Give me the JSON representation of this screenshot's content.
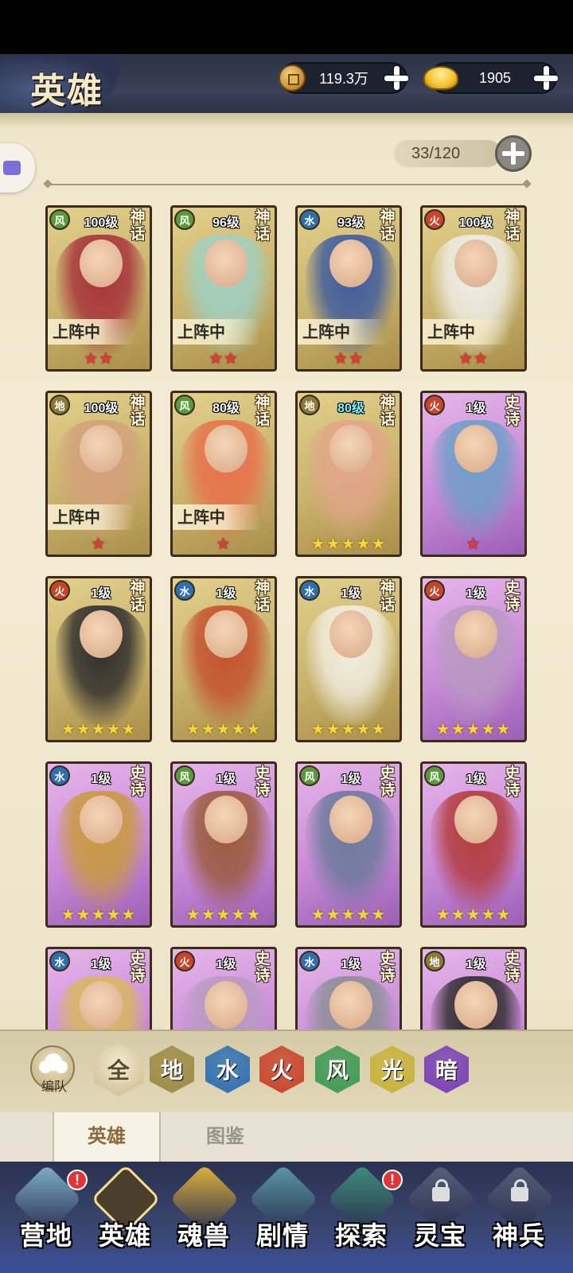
{
  "header": {
    "title": "英雄",
    "currencies": [
      {
        "icon": "copper-coin-icon",
        "amount": "119.3万"
      },
      {
        "icon": "gold-ingot-icon",
        "amount": "1905"
      }
    ]
  },
  "roster": {
    "capacity": "33/120"
  },
  "rarity_labels": {
    "myth": "神话",
    "epic": "史诗"
  },
  "elements": {
    "风": "#5a9a3a",
    "水": "#2e6fae",
    "火": "#c8442a",
    "地": "#8a7a3a"
  },
  "cards": [
    {
      "element": "风",
      "level": "100级",
      "rarity": "myth",
      "deployed": "上阵中",
      "stars": "★★",
      "star_color": "red",
      "tint": "#a6303a"
    },
    {
      "element": "风",
      "level": "96级",
      "rarity": "myth",
      "deployed": "上阵中",
      "stars": "★★",
      "star_color": "red",
      "tint": "#9fd1c4"
    },
    {
      "element": "水",
      "level": "93级",
      "rarity": "myth",
      "deployed": "上阵中",
      "stars": "★★",
      "star_color": "red",
      "tint": "#3b5aa0"
    },
    {
      "element": "火",
      "level": "100级",
      "rarity": "myth",
      "deployed": "上阵中",
      "stars": "★★",
      "star_color": "red",
      "tint": "#efefea"
    },
    {
      "element": "地",
      "level": "100级",
      "rarity": "myth",
      "deployed": "上阵中",
      "stars": "★",
      "star_color": "red",
      "tint": "#d3a07a"
    },
    {
      "element": "风",
      "level": "80级",
      "rarity": "myth",
      "deployed": "上阵中",
      "stars": "★",
      "star_color": "red",
      "tint": "#e9704a"
    },
    {
      "element": "地",
      "level": "80级",
      "rarity": "myth",
      "deployed": "",
      "stars": "★★★★★",
      "star_color": "gold",
      "tint": "#e2a58a",
      "level_cyan": true
    },
    {
      "element": "火",
      "level": "1级",
      "rarity": "epic",
      "deployed": "",
      "stars": "★",
      "star_color": "red",
      "tint": "#6d9ec8"
    },
    {
      "element": "火",
      "level": "1级",
      "rarity": "myth",
      "deployed": "",
      "stars": "★★★★★",
      "star_color": "gold",
      "tint": "#2b2b2b"
    },
    {
      "element": "水",
      "level": "1级",
      "rarity": "myth",
      "deployed": "",
      "stars": "★★★★★",
      "star_color": "gold",
      "tint": "#c4502e"
    },
    {
      "element": "水",
      "level": "1级",
      "rarity": "myth",
      "deployed": "",
      "stars": "★★★★★",
      "star_color": "gold",
      "tint": "#f2efe2"
    },
    {
      "element": "火",
      "level": "1级",
      "rarity": "epic",
      "deployed": "",
      "stars": "★★★★★",
      "star_color": "gold",
      "tint": "#b89ac2"
    },
    {
      "element": "水",
      "level": "1级",
      "rarity": "epic",
      "deployed": "",
      "stars": "★★★★★",
      "star_color": "gold",
      "tint": "#c99a3a"
    },
    {
      "element": "风",
      "level": "1级",
      "rarity": "epic",
      "deployed": "",
      "stars": "★★★★★",
      "star_color": "gold",
      "tint": "#9a5a3a"
    },
    {
      "element": "风",
      "level": "1级",
      "rarity": "epic",
      "deployed": "",
      "stars": "★★★★★",
      "star_color": "gold",
      "tint": "#6a7a9a"
    },
    {
      "element": "风",
      "level": "1级",
      "rarity": "epic",
      "deployed": "",
      "stars": "★★★★★",
      "star_color": "gold",
      "tint": "#b23a3a"
    },
    {
      "element": "水",
      "level": "1级",
      "rarity": "epic",
      "deployed": "",
      "stars": "",
      "star_color": "gold",
      "tint": "#d9b85a"
    },
    {
      "element": "火",
      "level": "1级",
      "rarity": "epic",
      "deployed": "",
      "stars": "",
      "star_color": "gold",
      "tint": "#b89ac2"
    },
    {
      "element": "水",
      "level": "1级",
      "rarity": "epic",
      "deployed": "",
      "stars": "",
      "star_color": "gold",
      "tint": "#8a8f96"
    },
    {
      "element": "地",
      "level": "1级",
      "rarity": "epic",
      "deployed": "",
      "stars": "",
      "star_color": "gold",
      "tint": "#2b2b2b"
    }
  ],
  "filters": {
    "team_label": "编队",
    "chips": [
      {
        "label": "全",
        "color": "#c9b98a",
        "selected": true
      },
      {
        "label": "地",
        "color": "#9d8a45"
      },
      {
        "label": "水",
        "color": "#2f6fb3"
      },
      {
        "label": "火",
        "color": "#c8442a"
      },
      {
        "label": "风",
        "color": "#3e9a55"
      },
      {
        "label": "光",
        "color": "#c9b23a"
      },
      {
        "label": "暗",
        "color": "#7a3fb8"
      }
    ]
  },
  "tabs": [
    {
      "label": "英雄",
      "active": true
    },
    {
      "label": "图鉴",
      "active": false
    }
  ],
  "nav": [
    {
      "label": "营地",
      "badge": "!",
      "color": "#7fb0c9"
    },
    {
      "label": "英雄",
      "active": true,
      "color": "#d8b24a"
    },
    {
      "label": "魂兽",
      "color": "#e2b43a"
    },
    {
      "label": "剧情",
      "color": "#5a9aa8"
    },
    {
      "label": "探索",
      "badge": "!",
      "color": "#3f8f7a"
    },
    {
      "label": "灵宝",
      "locked": true,
      "color": "#55607a"
    },
    {
      "label": "神兵",
      "locked": true,
      "color": "#55607a"
    }
  ]
}
